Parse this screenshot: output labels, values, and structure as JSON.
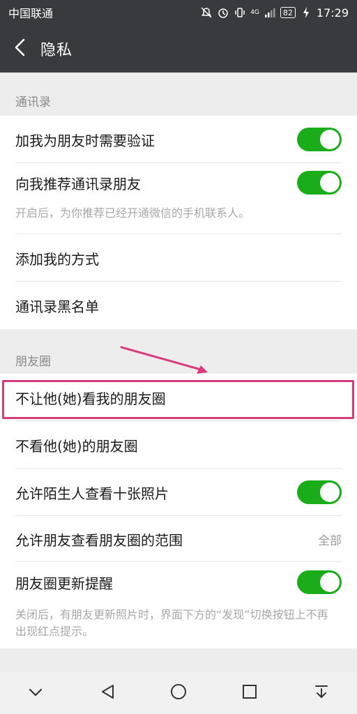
{
  "status_bar": {
    "carrier": "中国联通",
    "network": "4G",
    "battery": "82",
    "time": "17:29"
  },
  "title_bar": {
    "title": "隐私"
  },
  "sections": {
    "contacts": {
      "header": "通讯录",
      "verify_label": "加我为朋友时需要验证",
      "recommend_label": "向我推荐通讯录朋友",
      "recommend_hint": "开启后，为你推荐已经开通微信的手机联系人。",
      "add_methods_label": "添加我的方式",
      "blacklist_label": "通讯录黑名单"
    },
    "moments": {
      "header": "朋友圈",
      "hide_from_label": "不让他(她)看我的朋友圈",
      "dont_see_label": "不看他(她)的朋友圈",
      "stranger_photos_label": "允许陌生人查看十张照片",
      "range_label": "允许朋友查看朋友圈的范围",
      "range_value": "全部",
      "update_reminder_label": "朋友圈更新提醒",
      "update_reminder_hint": "关闭后，有朋友更新照片时，界面下方的“发现”切换按钮上不再出现红点提示。"
    }
  },
  "toggles": {
    "verify": true,
    "recommend": true,
    "stranger_photos": true,
    "update_reminder": true
  },
  "colors": {
    "header_bg": "#393a3f",
    "toggle_on": "#1aad19",
    "annotation": "#d63b7b"
  },
  "icons": {
    "back": "chevron-left-icon",
    "nav": [
      "chevron-down-icon",
      "triangle-back-icon",
      "circle-home-icon",
      "square-recents-icon",
      "download-icon"
    ]
  }
}
